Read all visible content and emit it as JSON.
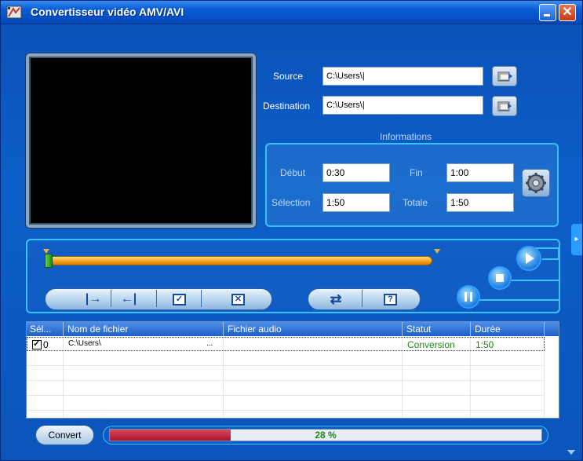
{
  "window": {
    "title": "Convertisseur vidéo AMV/AVI"
  },
  "source": {
    "label": "Source",
    "value": "C:\\Users\\|"
  },
  "destination": {
    "label": "Destination",
    "value": "C:\\Users\\|"
  },
  "info": {
    "title": "Informations",
    "debut_label": "Début",
    "debut_value": "0:30",
    "fin_label": "Fin",
    "fin_value": "1:00",
    "selection_label": "Sélection",
    "selection_value": "1:50",
    "totale_label": "Totale",
    "totale_value": "1:50"
  },
  "controls": {
    "set_start": "|→",
    "set_end": "←|",
    "help": "?"
  },
  "list": {
    "columns": [
      "Sél...",
      "Nom de fichier",
      "Fichier audio",
      "Statut",
      "Durée"
    ],
    "rows": [
      {
        "sel": "0",
        "file": "C:\\Users\\",
        "more": "...",
        "audio": "",
        "status": "Conversion",
        "duration": "1:50"
      }
    ]
  },
  "bottom": {
    "convert_label": "Convert",
    "progress_text": "28 %",
    "progress_fraction": 0.28
  },
  "colors": {
    "accent": "#3ac2ff",
    "progress": "#b0132b",
    "status_green": "#1c8a1c"
  }
}
